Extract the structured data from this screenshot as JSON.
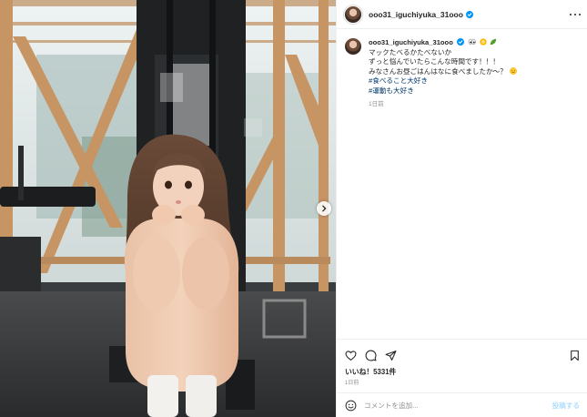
{
  "post": {
    "username": "ooo31_iguchiyuka_31ooo",
    "verified": true,
    "caption": {
      "line1_emojis": [
        "eyes-emoji",
        "sun-emoji",
        "leaf-emoji"
      ],
      "line2": "マックたべるかたべないか",
      "line3": "ずっと悩んでいたらこんな時間です！！！",
      "line4": "みなさんお昼ごはんはなに食べましたか〜？",
      "line4_emoji": "smile-emoji",
      "hashtag1": "#食べること大好き",
      "hashtag2": "#運動も大好き",
      "time_ago": "1日前"
    },
    "likes": "いいね！5331件",
    "posted": "1日前",
    "comment_placeholder": "コメントを追加...",
    "post_button": "投稿する"
  },
  "icons": {
    "verified": "verified-badge-icon",
    "more": "more-options-icon",
    "like": "heart-icon",
    "comment": "comment-icon",
    "share": "share-icon",
    "save": "bookmark-icon",
    "emoji": "emoji-icon",
    "next": "chevron-right-icon"
  },
  "colors": {
    "verified": "#0095f6",
    "hashtag": "#00376b",
    "muted": "#8e8e8e",
    "post_button": "#b2dffc",
    "text": "#262626"
  }
}
